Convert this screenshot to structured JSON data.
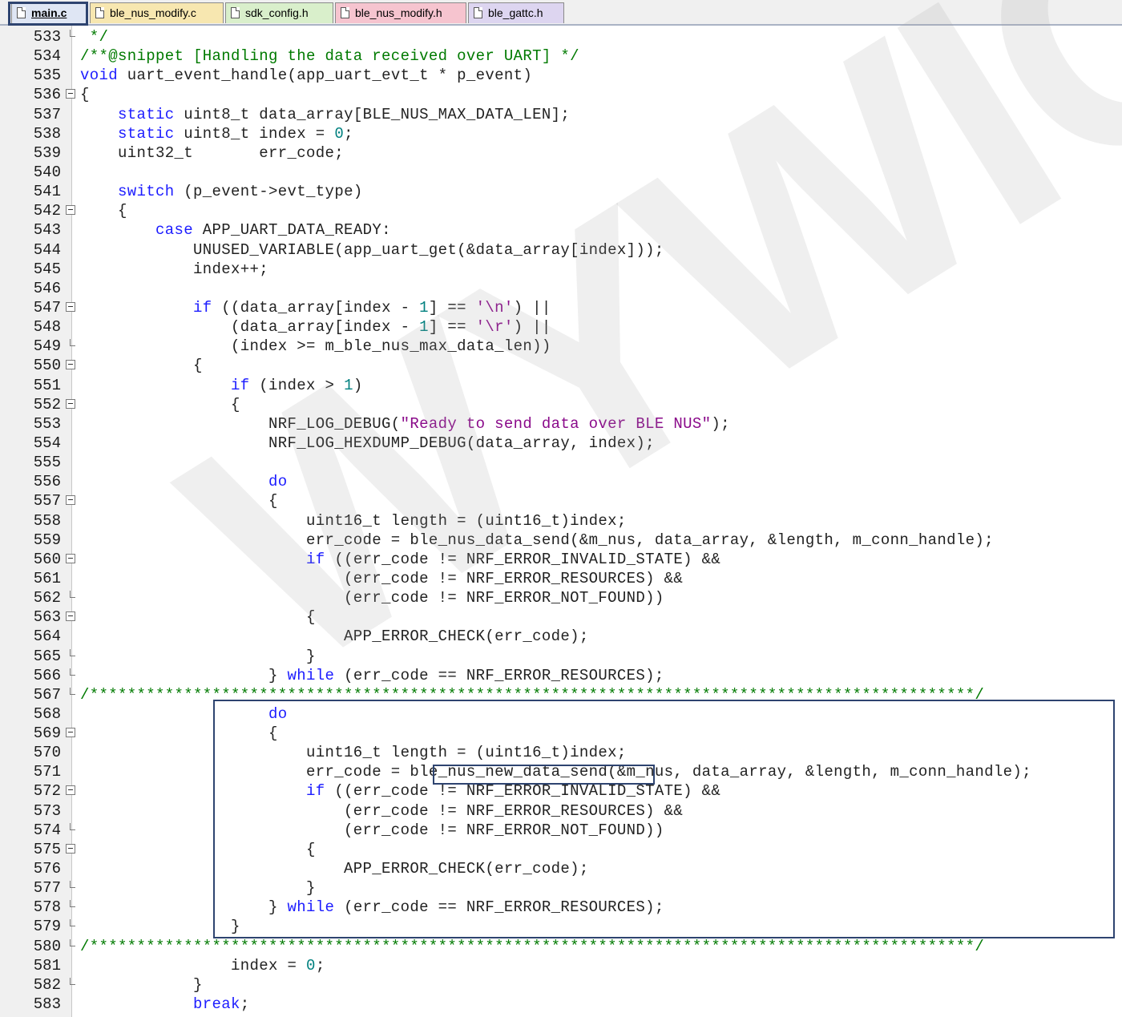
{
  "tabs": [
    {
      "label": "main.c",
      "color": "#dfe6f4",
      "active": true
    },
    {
      "label": "ble_nus_modify.c",
      "color": "#f7e7b0",
      "active": false
    },
    {
      "label": "sdk_config.h",
      "color": "#d9efcb",
      "active": false
    },
    {
      "label": "ble_nus_modify.h",
      "color": "#f6c4cf",
      "active": false
    },
    {
      "label": "ble_gattc.h",
      "color": "#ddd5f0",
      "active": false
    }
  ],
  "watermark": "WYWIOT",
  "code": {
    "lines": [
      {
        "n": "533",
        "fold": "end",
        "text": " */"
      },
      {
        "n": "534",
        "fold": "",
        "text": "/**@snippet [Handling the data received over UART] */"
      },
      {
        "n": "535",
        "fold": "",
        "text": "void uart_event_handle(app_uart_evt_t * p_event)"
      },
      {
        "n": "536",
        "fold": "open",
        "text": "{"
      },
      {
        "n": "537",
        "fold": "",
        "text": "    static uint8_t data_array[BLE_NUS_MAX_DATA_LEN];"
      },
      {
        "n": "538",
        "fold": "",
        "text": "    static uint8_t index = 0;"
      },
      {
        "n": "539",
        "fold": "",
        "text": "    uint32_t       err_code;"
      },
      {
        "n": "540",
        "fold": "",
        "text": ""
      },
      {
        "n": "541",
        "fold": "",
        "text": "    switch (p_event->evt_type)"
      },
      {
        "n": "542",
        "fold": "open",
        "text": "    {"
      },
      {
        "n": "543",
        "fold": "",
        "text": "        case APP_UART_DATA_READY:"
      },
      {
        "n": "544",
        "fold": "",
        "text": "            UNUSED_VARIABLE(app_uart_get(&data_array[index]));"
      },
      {
        "n": "545",
        "fold": "",
        "text": "            index++;"
      },
      {
        "n": "546",
        "fold": "",
        "text": ""
      },
      {
        "n": "547",
        "fold": "open",
        "text": "            if ((data_array[index - 1] == '\\n') ||"
      },
      {
        "n": "548",
        "fold": "",
        "text": "                (data_array[index - 1] == '\\r') ||"
      },
      {
        "n": "549",
        "fold": "end",
        "text": "                (index >= m_ble_nus_max_data_len))"
      },
      {
        "n": "550",
        "fold": "open",
        "text": "            {"
      },
      {
        "n": "551",
        "fold": "",
        "text": "                if (index > 1)"
      },
      {
        "n": "552",
        "fold": "open",
        "text": "                {"
      },
      {
        "n": "553",
        "fold": "",
        "text": "                    NRF_LOG_DEBUG(\"Ready to send data over BLE NUS\");"
      },
      {
        "n": "554",
        "fold": "",
        "text": "                    NRF_LOG_HEXDUMP_DEBUG(data_array, index);"
      },
      {
        "n": "555",
        "fold": "",
        "text": ""
      },
      {
        "n": "556",
        "fold": "",
        "text": "                    do"
      },
      {
        "n": "557",
        "fold": "open",
        "text": "                    {"
      },
      {
        "n": "558",
        "fold": "",
        "text": "                        uint16_t length = (uint16_t)index;"
      },
      {
        "n": "559",
        "fold": "",
        "text": "                        err_code = ble_nus_data_send(&m_nus, data_array, &length, m_conn_handle);"
      },
      {
        "n": "560",
        "fold": "open",
        "text": "                        if ((err_code != NRF_ERROR_INVALID_STATE) &&"
      },
      {
        "n": "561",
        "fold": "",
        "text": "                            (err_code != NRF_ERROR_RESOURCES) &&"
      },
      {
        "n": "562",
        "fold": "end",
        "text": "                            (err_code != NRF_ERROR_NOT_FOUND))"
      },
      {
        "n": "563",
        "fold": "open",
        "text": "                        {"
      },
      {
        "n": "564",
        "fold": "",
        "text": "                            APP_ERROR_CHECK(err_code);"
      },
      {
        "n": "565",
        "fold": "end",
        "text": "                        }"
      },
      {
        "n": "566",
        "fold": "end",
        "text": "                    } while (err_code == NRF_ERROR_RESOURCES);"
      },
      {
        "n": "567",
        "fold": "end",
        "text": "/**********************************************************************************************/"
      },
      {
        "n": "568",
        "fold": "",
        "text": "                    do"
      },
      {
        "n": "569",
        "fold": "open",
        "text": "                    {"
      },
      {
        "n": "570",
        "fold": "",
        "text": "                        uint16_t length = (uint16_t)index;"
      },
      {
        "n": "571",
        "fold": "",
        "text": "                        err_code = ble_nus_new_data_send(&m_nus, data_array, &length, m_conn_handle);"
      },
      {
        "n": "572",
        "fold": "open",
        "text": "                        if ((err_code != NRF_ERROR_INVALID_STATE) &&"
      },
      {
        "n": "573",
        "fold": "",
        "text": "                            (err_code != NRF_ERROR_RESOURCES) &&"
      },
      {
        "n": "574",
        "fold": "end",
        "text": "                            (err_code != NRF_ERROR_NOT_FOUND))"
      },
      {
        "n": "575",
        "fold": "open",
        "text": "                        {"
      },
      {
        "n": "576",
        "fold": "",
        "text": "                            APP_ERROR_CHECK(err_code);"
      },
      {
        "n": "577",
        "fold": "end",
        "text": "                        }"
      },
      {
        "n": "578",
        "fold": "end",
        "text": "                    } while (err_code == NRF_ERROR_RESOURCES);"
      },
      {
        "n": "579",
        "fold": "end",
        "text": "                }"
      },
      {
        "n": "580",
        "fold": "end",
        "text": "/**********************************************************************************************/"
      },
      {
        "n": "581",
        "fold": "",
        "text": "                index = 0;"
      },
      {
        "n": "582",
        "fold": "end",
        "text": "            }"
      },
      {
        "n": "583",
        "fold": "",
        "text": "            break;"
      }
    ]
  },
  "highlight": {
    "function_name": "ble_nus_new_data_send"
  }
}
